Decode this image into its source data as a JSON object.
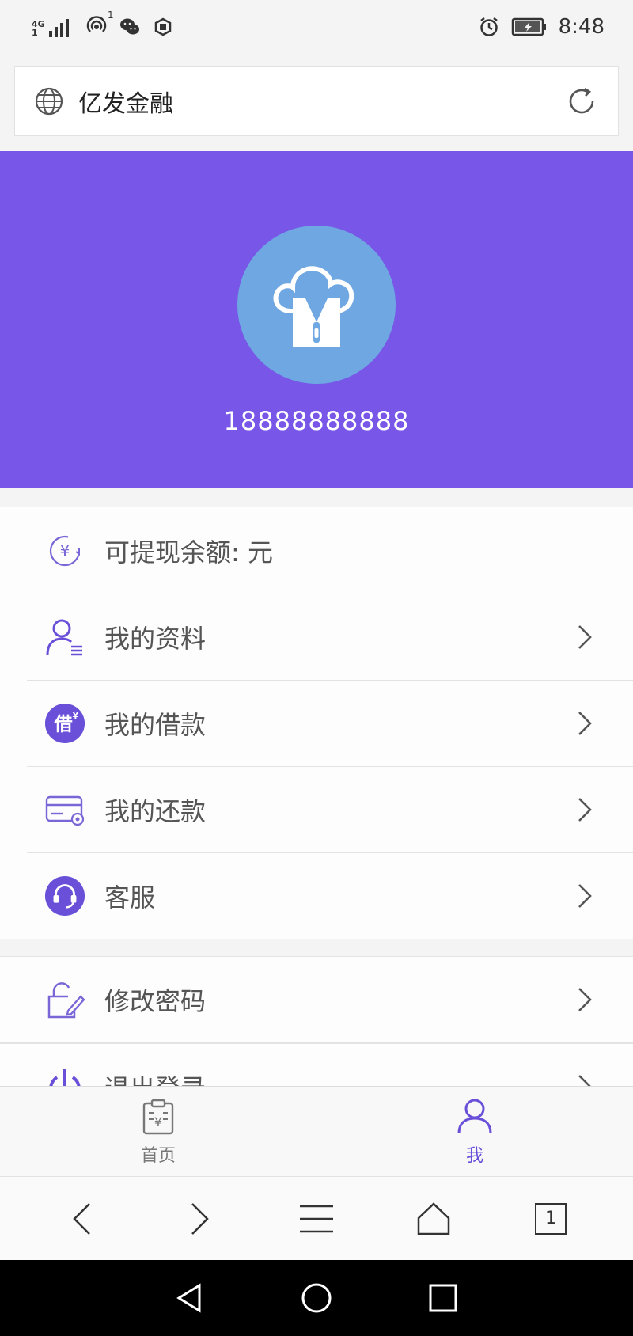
{
  "status_bar": {
    "network_top": "4G",
    "network_bottom": "1",
    "hotspot_badge": "1",
    "time": "8:48"
  },
  "browser": {
    "page_title": "亿发金融",
    "tab_count": "1"
  },
  "profile": {
    "phone": "18888888888"
  },
  "menu": {
    "balance_label": "可提现余额: 元",
    "items": [
      {
        "label": "我的资料",
        "icon": "user-profile-icon"
      },
      {
        "label": "我的借款",
        "icon": "loan-icon"
      },
      {
        "label": "我的还款",
        "icon": "repayment-card-icon"
      },
      {
        "label": "客服",
        "icon": "customer-service-icon"
      }
    ],
    "change_password": "修改密码",
    "logout": "退出登录"
  },
  "tabs": {
    "home": "首页",
    "me": "我"
  },
  "colors": {
    "primary_purple": "#7856e8",
    "avatar_blue": "#6ea7e2",
    "icon_purple": "#6a4fd8"
  }
}
